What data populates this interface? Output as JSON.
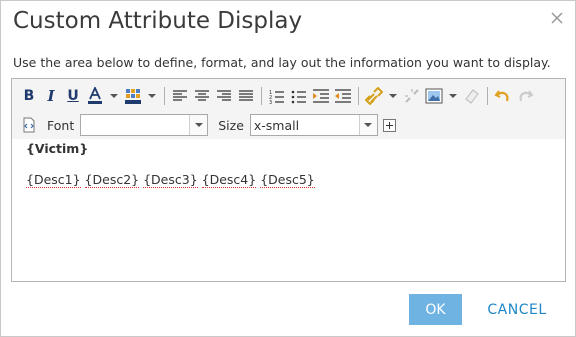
{
  "dialog": {
    "title": "Custom Attribute Display",
    "instructions": "Use the area below to define, format, and lay out the information you want to display."
  },
  "toolbar": {
    "bold": "B",
    "italic": "I",
    "underline": "U",
    "font_label": "Font",
    "font_value": "",
    "size_label": "Size",
    "size_value": "x-small"
  },
  "content": {
    "line1": "{Victim}",
    "fields": [
      "{Desc1}",
      "{Desc2}",
      "{Desc3}",
      "{Desc4}",
      "{Desc5}"
    ]
  },
  "buttons": {
    "ok": "OK",
    "cancel": "CANCEL"
  },
  "colors": {
    "accent": "#6fb3e3",
    "link": "#1f86c8"
  }
}
